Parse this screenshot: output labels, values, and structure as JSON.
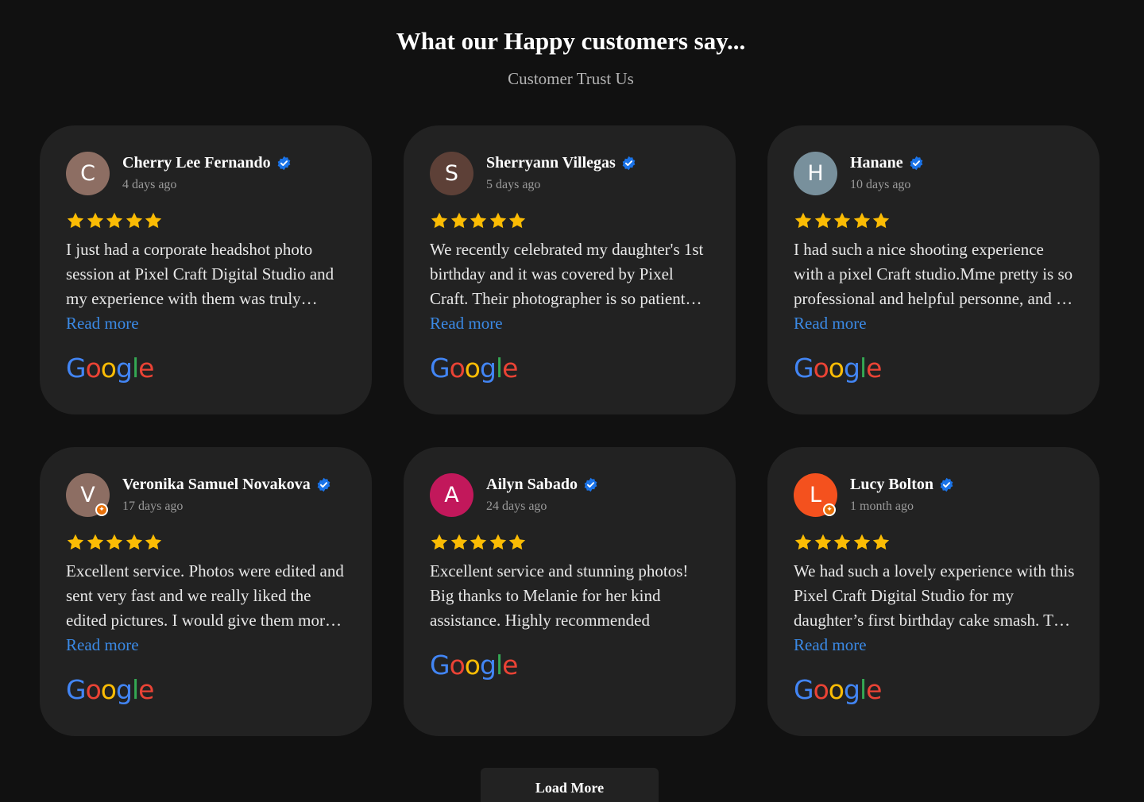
{
  "header": {
    "title": "What our Happy customers say...",
    "subtitle": "Customer Trust Us"
  },
  "colors": {
    "background": "#111111",
    "card": "#222222",
    "link": "#3b8ae6",
    "star": "#fbbc04",
    "verified": "#1a73e8"
  },
  "reviews": [
    {
      "initial": "C",
      "avatar_color": "#8d6e63",
      "has_badge": false,
      "name": "Cherry Lee Fernando",
      "date": "4 days ago",
      "rating": 5,
      "text": "I just had a corporate headshot photo session at Pixel Craft Digital Studio and my experience with them was truly exceptional from start to finish.",
      "read_more": "Read more",
      "source": "Google"
    },
    {
      "initial": "S",
      "avatar_color": "#5d4037",
      "has_badge": false,
      "name": "Sherryann Villegas",
      "date": "5 days ago",
      "rating": 5,
      "text": "We recently celebrated my daughter's 1st birthday and it was covered by Pixel Craft. Their photographer is so patient and great with kids.",
      "read_more": "Read more",
      "source": "Google"
    },
    {
      "initial": "H",
      "avatar_color": "#78909c",
      "has_badge": false,
      "name": "Hanane",
      "date": "10 days ago",
      "rating": 5,
      "text": "I had such a nice shooting experience with a pixel Craft studio.Mme pretty is so professional and helpful personne, and the whole team was lovely.",
      "read_more": "Read more",
      "source": "Google"
    },
    {
      "initial": "V",
      "avatar_color": "#8d6e63",
      "has_badge": true,
      "name": "Veronika Samuel Novakova",
      "date": "17 days ago",
      "rating": 5,
      "text": "Excellent service. Photos were edited and sent very fast and we really liked the edited pictures. I would give them more stars if I could.",
      "read_more": "Read more",
      "source": "Google"
    },
    {
      "initial": "A",
      "avatar_color": "#c2185b",
      "has_badge": false,
      "name": "Ailyn Sabado",
      "date": "24 days ago",
      "rating": 5,
      "text": "Excellent service and stunning photos! Big thanks to Melanie for her kind assistance. Highly recommended",
      "read_more": "",
      "source": "Google"
    },
    {
      "initial": "L",
      "avatar_color": "#f4511e",
      "has_badge": true,
      "name": "Lucy Bolton",
      "date": "1 month ago",
      "rating": 5,
      "text": "We had such a lovely experience with this Pixel Craft Digital Studio for my daughter’s first birthday cake smash. The photos came out beautifully.",
      "read_more": "Read more",
      "source": "Google"
    }
  ],
  "load_more_label": "Load More"
}
